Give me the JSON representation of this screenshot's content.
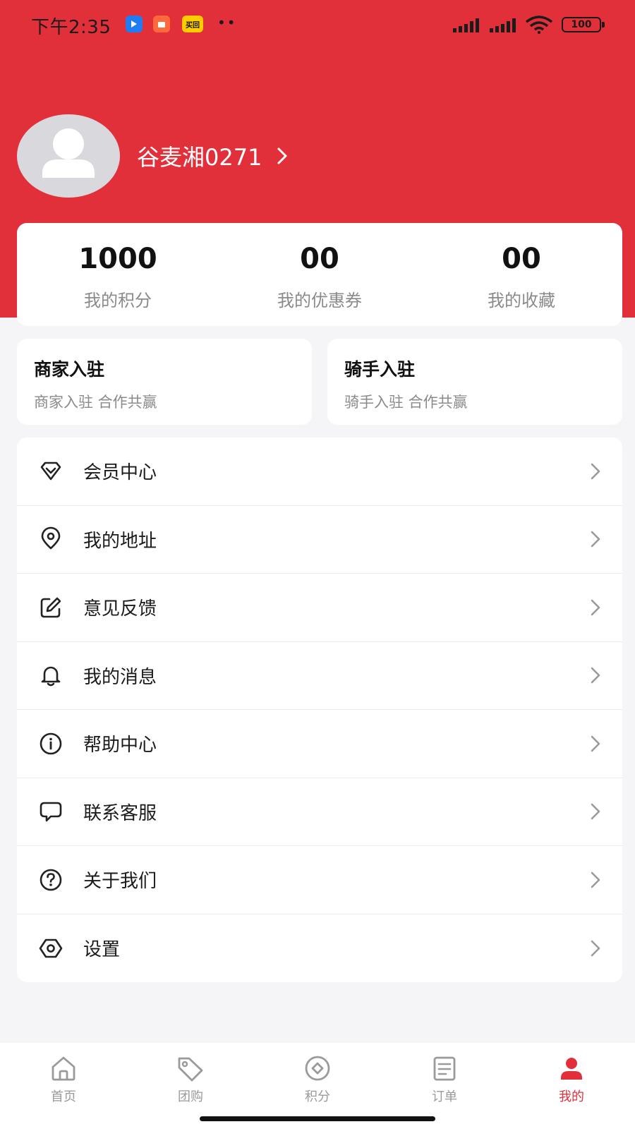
{
  "status_bar": {
    "time": "下午2:35",
    "badge_3_text": "买回",
    "dots": "••",
    "battery": "100"
  },
  "colors": {
    "brand": "#e2303a",
    "background": "#f5f5f7",
    "card": "#ffffff",
    "muted_text": "#8a8a8a"
  },
  "profile": {
    "username": "谷麦湘0271",
    "avatar_icon": "user-avatar-icon"
  },
  "stats": [
    {
      "value": "1000",
      "label": "我的积分"
    },
    {
      "value": "00",
      "label": "我的优惠券"
    },
    {
      "value": "00",
      "label": "我的收藏"
    }
  ],
  "join": {
    "merchant": {
      "title": "商家入驻",
      "subtitle": "商家入驻 合作共赢"
    },
    "rider": {
      "title": "骑手入驻",
      "subtitle": "骑手入驻 合作共赢"
    }
  },
  "menu": [
    {
      "label": "会员中心",
      "icon": "diamond-icon"
    },
    {
      "label": "我的地址",
      "icon": "location-pin-icon"
    },
    {
      "label": "意见反馈",
      "icon": "edit-icon"
    },
    {
      "label": "我的消息",
      "icon": "bell-icon"
    },
    {
      "label": "帮助中心",
      "icon": "info-icon"
    },
    {
      "label": "联系客服",
      "icon": "chat-bubble-icon"
    },
    {
      "label": "关于我们",
      "icon": "question-icon"
    },
    {
      "label": "设置",
      "icon": "settings-icon"
    }
  ],
  "tabs": [
    {
      "label": "首页",
      "icon": "home-icon",
      "active": false
    },
    {
      "label": "团购",
      "icon": "tag-icon",
      "active": false
    },
    {
      "label": "积分",
      "icon": "points-icon",
      "active": false
    },
    {
      "label": "订单",
      "icon": "order-list-icon",
      "active": false
    },
    {
      "label": "我的",
      "icon": "profile-icon",
      "active": true
    }
  ]
}
